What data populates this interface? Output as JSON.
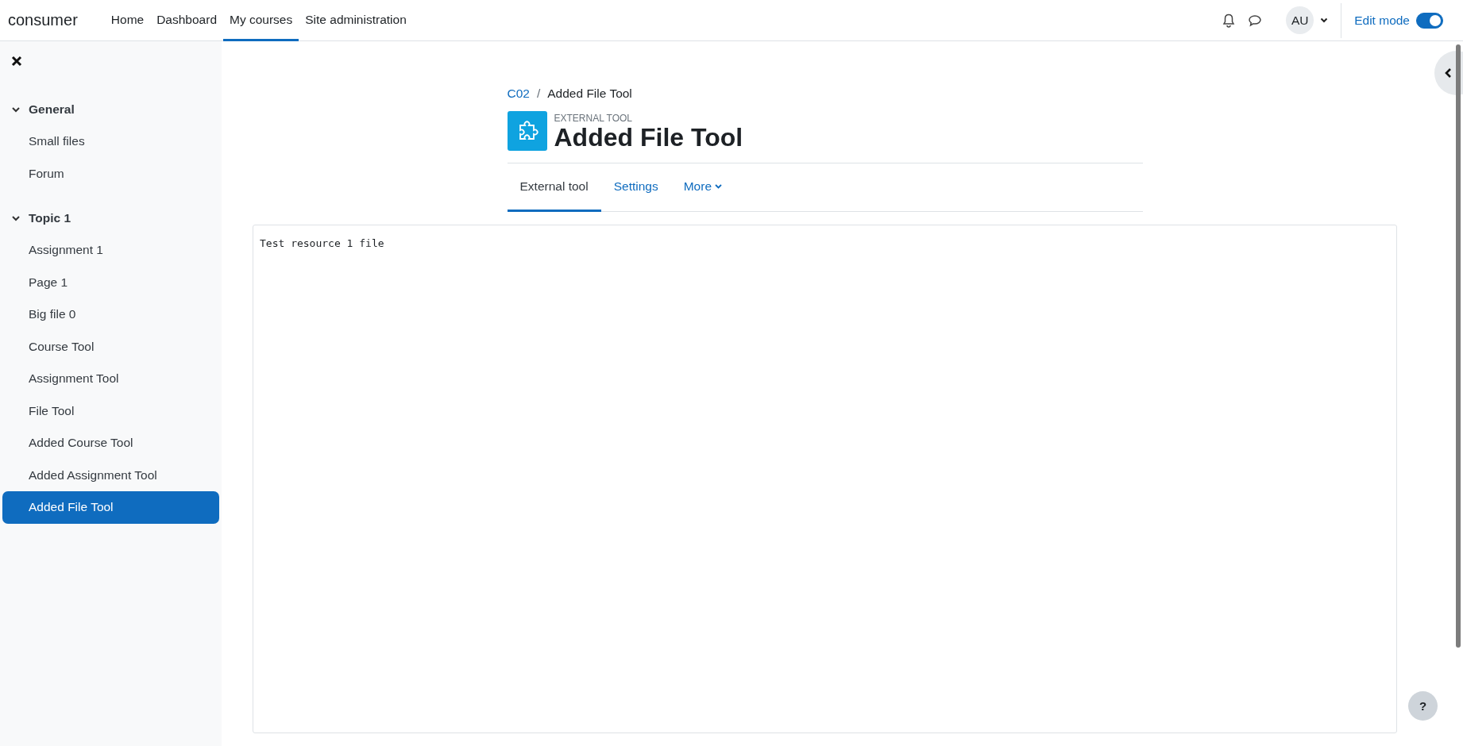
{
  "site_name": "consumer",
  "nav": [
    {
      "label": "Home",
      "selected": false
    },
    {
      "label": "Dashboard",
      "selected": false
    },
    {
      "label": "My courses",
      "selected": true
    },
    {
      "label": "Site administration",
      "selected": false
    }
  ],
  "user": {
    "initials": "AU"
  },
  "edit_mode": {
    "label": "Edit mode",
    "on": true
  },
  "course_index": [
    {
      "title": "General",
      "expanded": true,
      "children": [
        {
          "label": "Small files",
          "selected": false
        },
        {
          "label": "Forum",
          "selected": false
        }
      ]
    },
    {
      "title": "Topic 1",
      "expanded": true,
      "children": [
        {
          "label": "Assignment 1",
          "selected": false
        },
        {
          "label": "Page 1",
          "selected": false
        },
        {
          "label": "Big file 0",
          "selected": false
        },
        {
          "label": "Course Tool",
          "selected": false
        },
        {
          "label": "Assignment Tool",
          "selected": false
        },
        {
          "label": "File Tool",
          "selected": false
        },
        {
          "label": "Added Course Tool",
          "selected": false
        },
        {
          "label": "Added Assignment Tool",
          "selected": false
        },
        {
          "label": "Added File Tool",
          "selected": true
        }
      ]
    }
  ],
  "breadcrumb": [
    {
      "label": "C02",
      "kind": "link"
    },
    {
      "label": "/",
      "kind": "separator"
    },
    {
      "label": "Added File Tool",
      "kind": "current"
    }
  ],
  "header": {
    "type_label": "EXTERNAL TOOL",
    "title": "Added File Tool"
  },
  "tabs": [
    {
      "label": "External tool",
      "selected": true,
      "kind": "tab"
    },
    {
      "label": "Settings",
      "selected": false,
      "kind": "tab"
    },
    {
      "label": "More",
      "selected": false,
      "kind": "menu"
    }
  ],
  "frame": {
    "text": "Test resource 1 file"
  },
  "help": {
    "label": "?"
  }
}
